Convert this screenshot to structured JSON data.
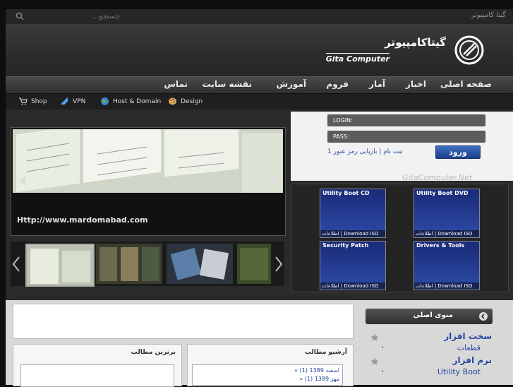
{
  "topbar": {
    "site_name": "گیتا کامپیوتر",
    "search_placeholder": "جستجو..."
  },
  "header": {
    "logo_fa": "گیتاکامپیوتر",
    "logo_en": "Gita Computer"
  },
  "main_nav": [
    "صفحه اصلی",
    "اخبار",
    "آمار",
    "فروم",
    "آموزش",
    "نقشه سایت",
    "تماس"
  ],
  "sub_nav": [
    {
      "label": "Shop",
      "icon": "cart-icon"
    },
    {
      "label": "VPN",
      "icon": "vpn-icon"
    },
    {
      "label": "Host & Domain",
      "icon": "globe-icon"
    },
    {
      "label": "Design",
      "icon": "palette-icon"
    }
  ],
  "slider": {
    "caption": "Http://www.mardomabad.com"
  },
  "login": {
    "login_label": "LOGIN:",
    "pass_label": "PASS:",
    "button": "ورود",
    "register": "ثبت نام",
    "forgot": "بازیابی رمز عبور",
    "separator": "|",
    "count": "1"
  },
  "watermark": "GitaComputer.Net",
  "products": [
    {
      "title": "Utility Boot CD",
      "links": "اطلاعات | Download ISO"
    },
    {
      "title": "Utility Boot DVD",
      "links": "اطلاعات | Download ISO"
    },
    {
      "title": "Security Patch",
      "links": "اطلاعات | Download ISO"
    },
    {
      "title": "Drivers & Tools",
      "links": "اطلاعات | Download ISO"
    }
  ],
  "columns": {
    "top_articles": "برترین مطالب",
    "archive": "آرشیو مطالب",
    "archive_items": [
      "« اسفند 1389 (1)",
      "« مهر 1389 (1)"
    ]
  },
  "menu": {
    "title": "منوی اصلی",
    "items": [
      {
        "label": "سخت افزار",
        "big": true
      },
      {
        "label": "قطعات",
        "big": false
      },
      {
        "label": "نرم افزار",
        "big": true
      },
      {
        "label": "Utility Boot",
        "big": false
      }
    ]
  },
  "colors": {
    "accent_blue": "#2547a0",
    "nav_bg": "#3a3a3a"
  }
}
